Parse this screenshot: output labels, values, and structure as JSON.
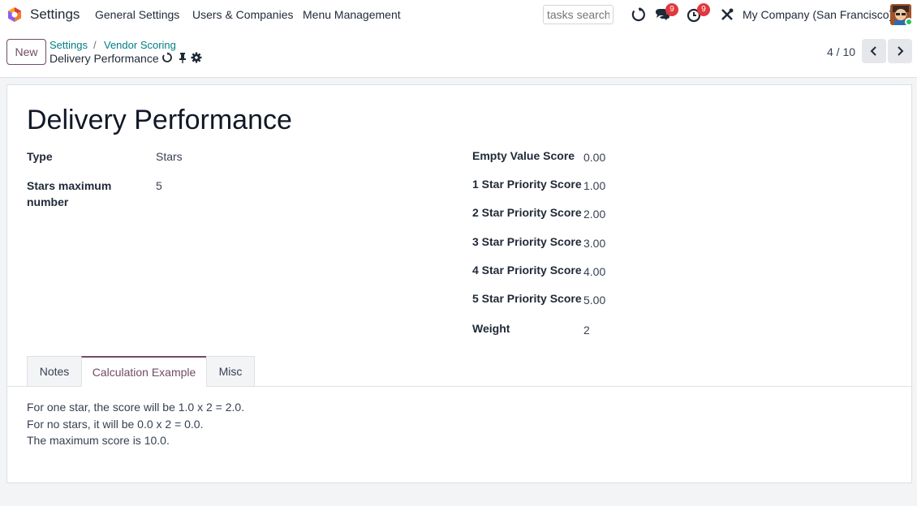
{
  "navbar": {
    "app_title": "Settings",
    "menu": [
      "General Settings",
      "Users & Companies",
      "Menu Management"
    ],
    "search_placeholder": "tasks search",
    "messages_badge": "9",
    "activities_badge": "9",
    "company": "My Company (San Francisco)"
  },
  "control_panel": {
    "new_label": "New",
    "breadcrumb": [
      "Settings",
      "Vendor Scoring"
    ],
    "breadcrumb_sep": "/",
    "record_name": "Delivery Performance",
    "pager": "4 / 10"
  },
  "form": {
    "title": "Delivery Performance",
    "left_fields": [
      {
        "label": "Type",
        "value": "Stars"
      },
      {
        "label": "Stars maximum number",
        "value": "5"
      }
    ],
    "right_fields": [
      {
        "label": "Empty Value Score",
        "value": "0.00"
      },
      {
        "label": "1 Star Priority Score",
        "value": "1.00"
      },
      {
        "label": "2 Star Priority Score",
        "value": "2.00"
      },
      {
        "label": "3 Star Priority Score",
        "value": "3.00"
      },
      {
        "label": "4 Star Priority Score",
        "value": "4.00"
      },
      {
        "label": "5 Star Priority Score",
        "value": "5.00"
      },
      {
        "label": "Weight",
        "value": "2"
      }
    ],
    "tabs": [
      {
        "label": "Notes",
        "active": false
      },
      {
        "label": "Calculation Example",
        "active": true
      },
      {
        "label": "Misc",
        "active": false
      }
    ],
    "calculation_lines": [
      "For one star, the score will be 1.0 x 2 = 2.0.",
      "For no stars, it will be 0.0 x 2 = 0.0.",
      "The maximum score is 10.0."
    ]
  },
  "colors": {
    "accent": "#714b67",
    "link": "#017e84",
    "badge": "#e0383e"
  }
}
